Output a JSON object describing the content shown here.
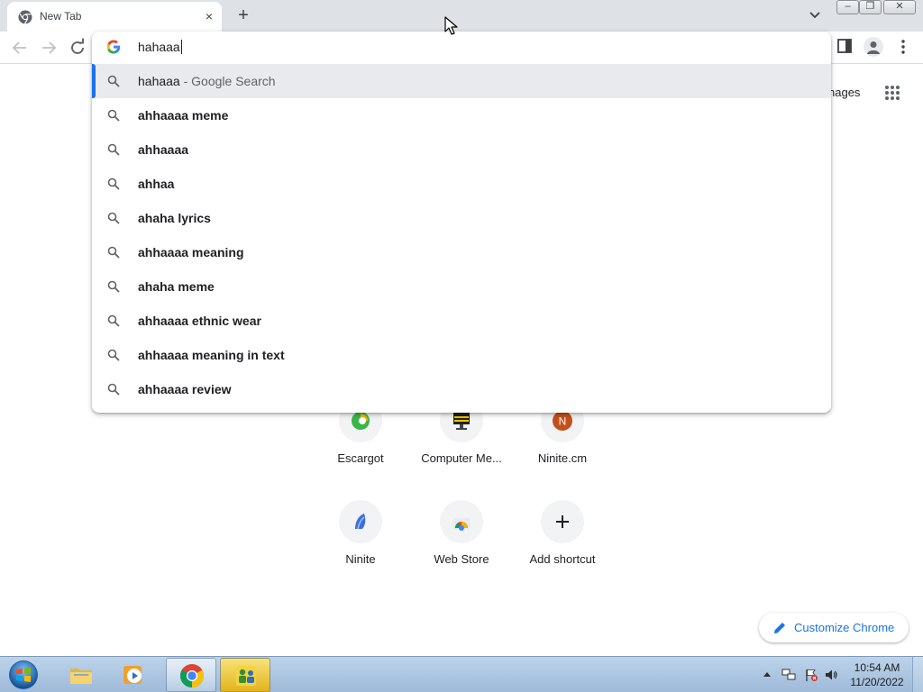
{
  "browser": {
    "tab": {
      "title": "New Tab",
      "close_glyph": "×"
    },
    "new_tab_glyph": "+",
    "window_controls": {
      "minimize": "–",
      "maximize": "❐",
      "close": "✕"
    }
  },
  "omnibox": {
    "value": "hahaaa",
    "suggestions": [
      {
        "text": "hahaaa",
        "suffix": " - Google Search",
        "selected": true
      },
      {
        "text": "ahhaaaa meme"
      },
      {
        "text": "ahhaaaa"
      },
      {
        "text": "ahhaa"
      },
      {
        "text": "ahaha lyrics"
      },
      {
        "text": "ahhaaaa meaning"
      },
      {
        "text": "ahaha meme"
      },
      {
        "text": "ahhaaaa ethnic wear"
      },
      {
        "text": "ahhaaaa meaning in text"
      },
      {
        "text": "ahhaaaa review"
      }
    ]
  },
  "ntp": {
    "images_link": "nages",
    "shortcuts": [
      {
        "label": "Escargot",
        "icon": "escargot-icon"
      },
      {
        "label": "Computer Me...",
        "icon": "computer-icon"
      },
      {
        "label": "Ninite.cm",
        "icon": "ninite-n-icon",
        "letter": "N"
      },
      {
        "label": "Ninite",
        "icon": "ninite-icon"
      },
      {
        "label": "Web Store",
        "icon": "web-store-icon"
      },
      {
        "label": "Add shortcut",
        "icon": "plus-icon"
      }
    ],
    "customize_label": "Customize Chrome"
  },
  "taskbar": {
    "clock": {
      "time": "10:54 AM",
      "date": "11/20/2022"
    }
  },
  "colors": {
    "accent": "#1a73e8",
    "tabstrip": "#dee1e6",
    "selected_row": "#e8eaed"
  }
}
